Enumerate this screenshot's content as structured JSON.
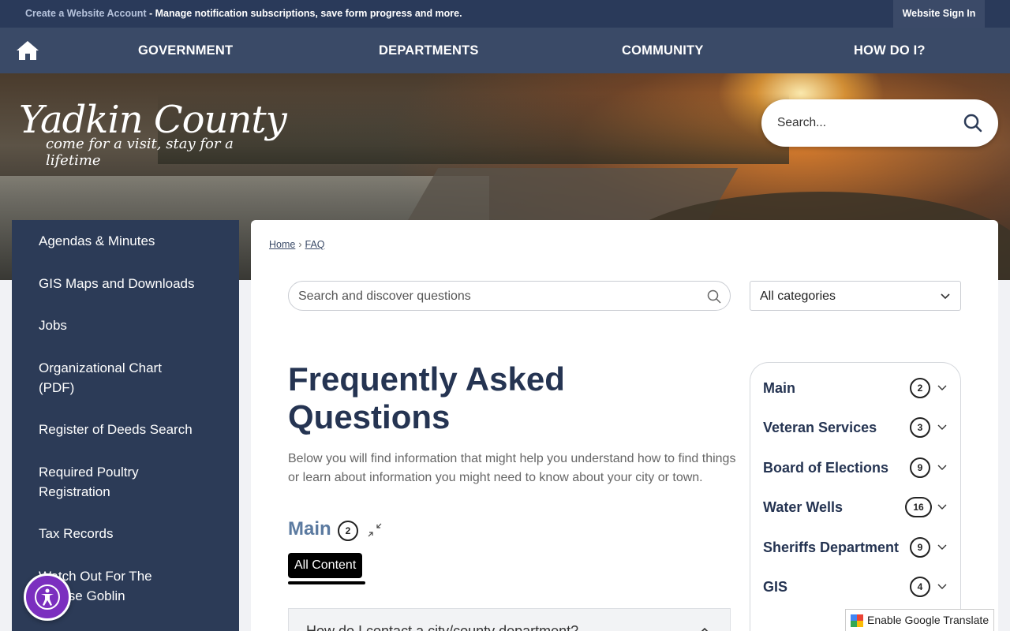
{
  "topbar": {
    "create_link": "Create a Website Account",
    "message": " - Manage notification subscriptions, save form progress and more.",
    "signin": "Website Sign In"
  },
  "nav": {
    "home_icon": "home-icon",
    "items": [
      "GOVERNMENT",
      "DEPARTMENTS",
      "COMMUNITY",
      "HOW DO I?"
    ]
  },
  "hero": {
    "logo_title": "Yadkin County",
    "logo_tagline": "come for a visit, stay for a lifetime",
    "search_placeholder": "Search..."
  },
  "sidebar": {
    "items": [
      "Agendas & Minutes",
      "GIS Maps and Downloads",
      "Jobs",
      "Organizational Chart (PDF)",
      "Register of Deeds Search",
      "Required Poultry Registration",
      "Tax Records",
      "Watch Out For The Grease Goblin"
    ]
  },
  "breadcrumb": {
    "home": "Home",
    "sep": "›",
    "current": "FAQ"
  },
  "faq": {
    "search_placeholder": "Search and discover questions",
    "category_select": "All categories",
    "title": "Frequently Asked Questions",
    "intro": "Below you will find information that might help you understand how to find things or learn about information you might need to know about your city or town.",
    "section_name": "Main",
    "section_count": "2",
    "tab_all": "All Content",
    "first_question": "How do I contact a city/county department?"
  },
  "categories": [
    {
      "label": "Main",
      "count": "2"
    },
    {
      "label": "Veteran Services",
      "count": "3"
    },
    {
      "label": "Board of Elections",
      "count": "9"
    },
    {
      "label": "Water Wells",
      "count": "16"
    },
    {
      "label": "Sheriffs Department",
      "count": "9"
    },
    {
      "label": "GIS",
      "count": "4"
    }
  ],
  "translate": {
    "label": "Enable Google Translate"
  },
  "colors": {
    "navy": "#2c3b57",
    "accent_purple": "#7b2fbf",
    "section_blue": "#5b7aa0"
  }
}
